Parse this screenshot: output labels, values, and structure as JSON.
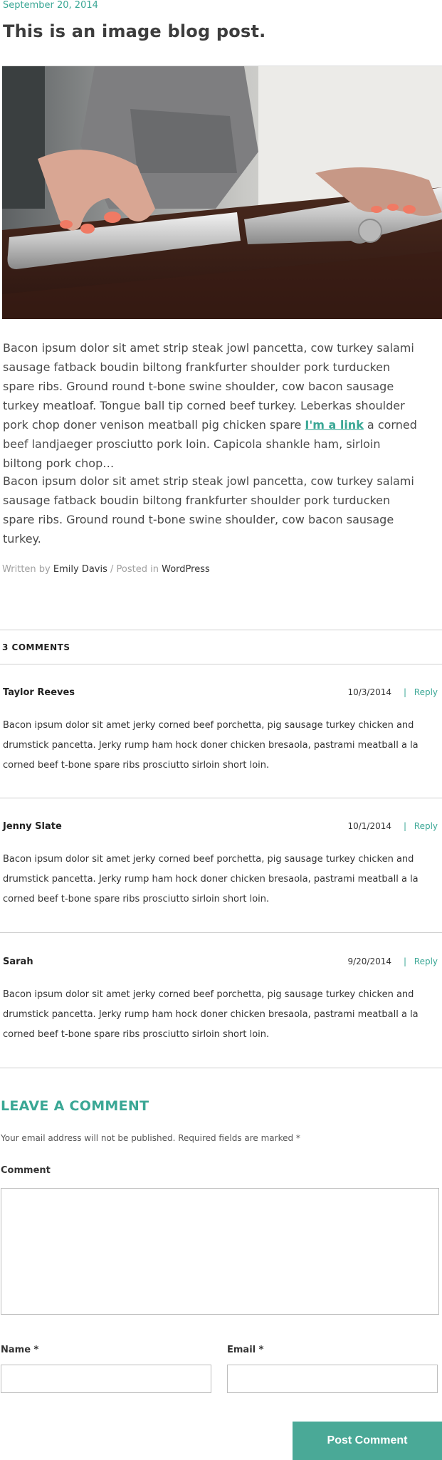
{
  "post": {
    "date": "September 20, 2014",
    "title": "This is an image blog post.",
    "hero_image_alt": "hands typing on keyboard",
    "paragraph1_before_link": "Bacon ipsum dolor sit amet strip steak jowl pancetta, cow turkey salami sausage fatback boudin biltong frankfurter shoulder pork turducken spare ribs. Ground round t-bone swine shoulder, cow bacon sausage turkey meatloaf. Tongue ball tip corned beef turkey. Leberkas shoulder pork chop doner venison meatball pig chicken spare ",
    "paragraph1_link": "I'm a link",
    "paragraph1_after_link": " a corned beef landjaeger prosciutto pork loin. Capicola shankle ham, sirloin biltong pork chop…",
    "paragraph2": "Bacon ipsum dolor sit amet strip steak jowl pancetta, cow turkey salami sausage fatback boudin biltong frankfurter shoulder pork turducken spare ribs. Ground round t-bone swine shoulder, cow bacon sausage turkey.",
    "meta": {
      "written_by_label": "Written by",
      "author": "Emily Davis",
      "posted_in_label": " / Posted in",
      "category": "WordPress"
    }
  },
  "comments": {
    "heading": "3 COMMENTS",
    "items": [
      {
        "author": "Taylor Reeves",
        "date": "10/3/2014",
        "separator": "|",
        "reply": "Reply",
        "body": "Bacon ipsum dolor sit amet jerky corned beef porchetta, pig sausage turkey chicken and drumstick pancetta. Jerky rump ham hock doner chicken bresaola, pastrami meatball a la corned beef t-bone spare ribs prosciutto sirloin short loin."
      },
      {
        "author": "Jenny Slate",
        "date": "10/1/2014",
        "separator": "|",
        "reply": "Reply",
        "body": "Bacon ipsum dolor sit amet jerky corned beef porchetta, pig sausage turkey chicken and drumstick pancetta. Jerky rump ham hock doner chicken bresaola, pastrami meatball a la corned beef t-bone spare ribs prosciutto sirloin short loin."
      },
      {
        "author": "Sarah",
        "date": "9/20/2014",
        "separator": "|",
        "reply": "Reply",
        "body": "Bacon ipsum dolor sit amet jerky corned beef porchetta, pig sausage turkey chicken and drumstick pancetta. Jerky rump ham hock doner chicken bresaola, pastrami meatball a la corned beef t-bone spare ribs prosciutto sirloin short loin."
      }
    ]
  },
  "comment_form": {
    "title": "LEAVE A COMMENT",
    "note": "Your email address will not be published. Required fields are marked *",
    "comment_label": "Comment",
    "name_label": "Name *",
    "email_label": "Email *",
    "submit_label": "Post Comment"
  },
  "colors": {
    "accent": "#3aa795",
    "button": "#4aa997"
  }
}
